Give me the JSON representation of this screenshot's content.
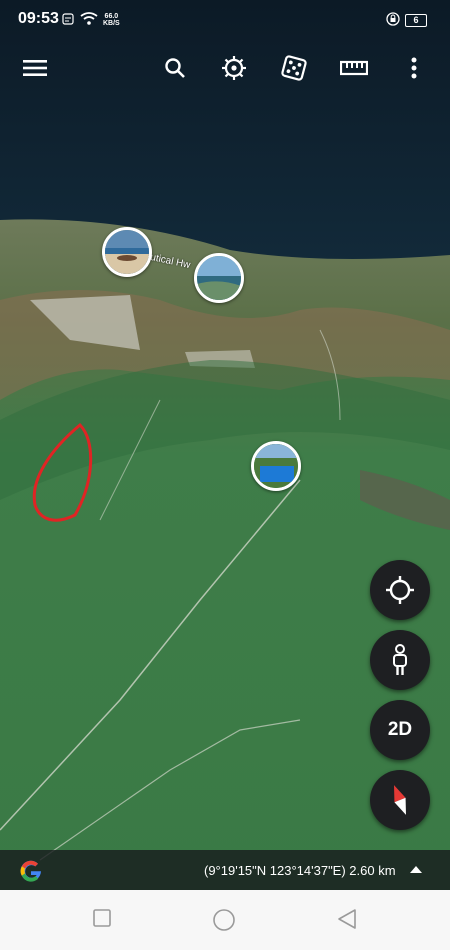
{
  "status_bar": {
    "time": "09:53",
    "net_speed_value": "66.0",
    "net_speed_unit": "KB/S",
    "battery": "6",
    "icons": [
      "notification-icon",
      "wifi-icon",
      "lock-rotation-icon",
      "battery-icon"
    ]
  },
  "toolbar": {
    "icons": [
      "menu-icon",
      "search-icon",
      "voyager-icon",
      "feeling-lucky-dice-icon",
      "measure-ruler-icon",
      "more-vert-icon"
    ]
  },
  "map": {
    "road_label": "utical Hw",
    "photo_markers": [
      "beach-photo",
      "coast-photo",
      "pool-photo"
    ],
    "annotation_color": "#e02424"
  },
  "controls": {
    "my_location_icon": "crosshair-icon",
    "street_view_icon": "pegman-icon",
    "view_mode_label": "2D",
    "compass_icon": "compass-icon"
  },
  "bottom_bar": {
    "coordinates": "(9°19'15\"N 123°14'37\"E) 2.60 km"
  },
  "nav_bar": {
    "icons": [
      "recent-apps-icon",
      "home-icon",
      "back-icon"
    ]
  },
  "colors": {
    "fab_bg": "#1e1f22",
    "water": "#173546",
    "vegetation": "#3d7a48",
    "annotation": "#e02424"
  }
}
